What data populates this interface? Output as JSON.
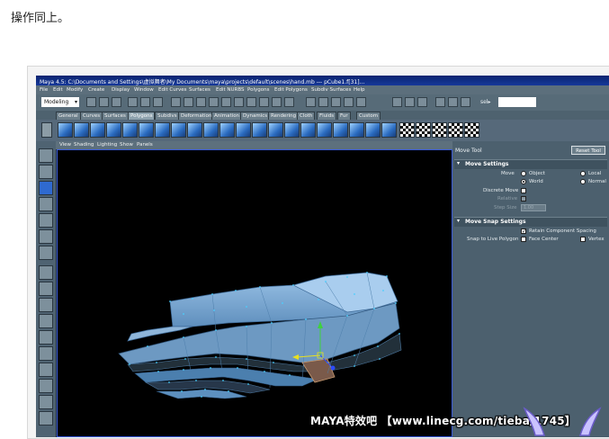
{
  "caption": "操作同上。",
  "window": {
    "title": "Maya 4.5: C:\\Documents and Settings\\虚拟舞者\\My Documents\\maya\\projects\\default\\scenes\\hand.mb   ---   pCube1.f[31]..."
  },
  "menubar": [
    "File",
    "Edit",
    "Modify",
    "Create",
    "Display",
    "Window",
    "Edit Curves",
    "Surfaces",
    "Edit NURBS",
    "Polygons",
    "Edit Polygons",
    "Subdiv Surfaces",
    "Help"
  ],
  "statusline": {
    "mode": "Modeling",
    "sel_label": "sel▸"
  },
  "shelf_tabs": [
    "General",
    "Curves",
    "Surfaces",
    "Polygons",
    "Subdivs",
    "Deformation",
    "Animation",
    "Dynamics",
    "Rendering",
    "Cloth",
    "Fluids",
    "Fur",
    "Custom"
  ],
  "active_shelf_tab": "Polygons",
  "viewport_menu": [
    "View",
    "Shading",
    "Lighting",
    "Show",
    "Panels"
  ],
  "panel": {
    "title": "Move Tool",
    "reset_label": "Reset Tool",
    "move_settings": {
      "header": "Move Settings",
      "move_label": "Move",
      "options": [
        "Object",
        "Local",
        "World",
        "Normal"
      ],
      "selected": "World",
      "discrete_label": "Discrete Move",
      "discrete_checked": false,
      "relative_label": "Relative",
      "step_label": "Step Size",
      "step_value": "1.00"
    },
    "snap_settings": {
      "header": "Move Snap Settings",
      "retain_label": "Retain Component Spacing",
      "retain_checked": true,
      "snap_label": "Snap to Live Polygon",
      "face_center_label": "Face Center",
      "vertex_label": "Vertex"
    }
  },
  "watermark": "MAYA特效吧 【www.linecg.com/tieba/1745】"
}
